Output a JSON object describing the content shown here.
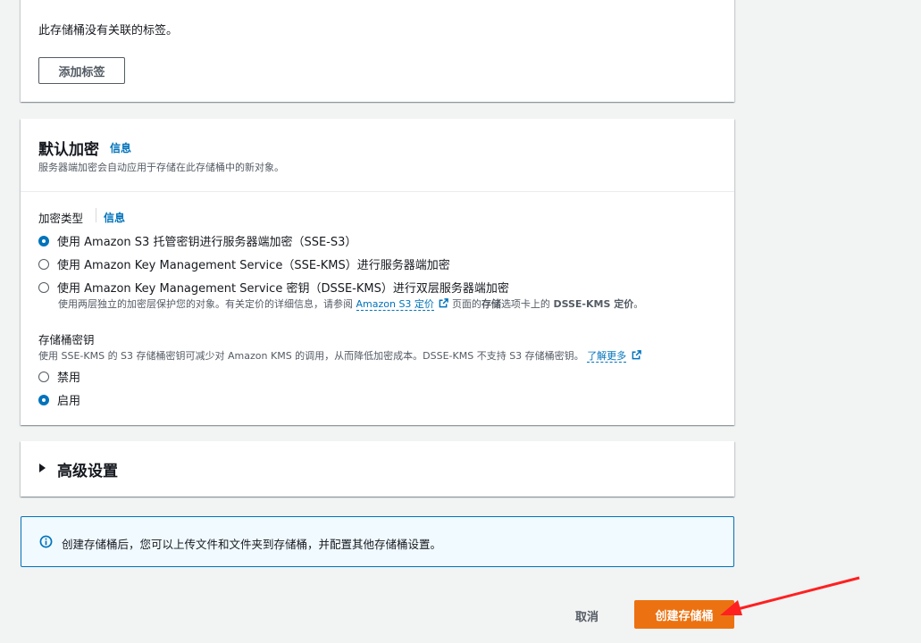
{
  "tags": {
    "empty_text": "此存储桶没有关联的标签。",
    "add_button": "添加标签"
  },
  "encryption": {
    "title": "默认加密",
    "info": "信息",
    "description": "服务器端加密会自动应用于存储在此存储桶中的新对象。",
    "type_label": "加密类型",
    "type_info": "信息",
    "options": [
      {
        "label": "使用 Amazon S3 托管密钥进行服务器端加密（SSE-S3）",
        "checked": true
      },
      {
        "label": "使用 Amazon Key Management Service（SSE-KMS）进行服务器端加密",
        "checked": false
      },
      {
        "label": "使用 Amazon Key Management Service 密钥（DSSE-KMS）进行双层服务器端加密",
        "checked": false
      }
    ],
    "dsse_desc_prefix": "使用两层独立的加密层保护您的对象。有关定价的详细信息，请参阅",
    "dsse_desc_link": "Amazon S3 定价",
    "dsse_desc_mid": "页面的",
    "dsse_desc_bold1": "存储",
    "dsse_desc_mid2": "选项卡上的",
    "dsse_desc_bold2": "DSSE-KMS 定价",
    "dsse_desc_end": "。",
    "bucket_key_label": "存储桶密钥",
    "bucket_key_desc": "使用 SSE-KMS 的 S3 存储桶密钥可减少对 Amazon KMS 的调用，从而降低加密成本。DSSE-KMS 不支持 S3 存储桶密钥。",
    "learn_more": "了解更多",
    "bucket_key_options": [
      {
        "label": "禁用",
        "checked": false
      },
      {
        "label": "启用",
        "checked": true
      }
    ]
  },
  "advanced": {
    "title": "高级设置"
  },
  "alert": {
    "text": "创建存储桶后，您可以上传文件和文件夹到存储桶，并配置其他存储桶设置。"
  },
  "footer": {
    "cancel": "取消",
    "create": "创建存储桶"
  },
  "colors": {
    "primary": "#ec7211",
    "link": "#0073bb",
    "arrow": "#ff2020"
  }
}
